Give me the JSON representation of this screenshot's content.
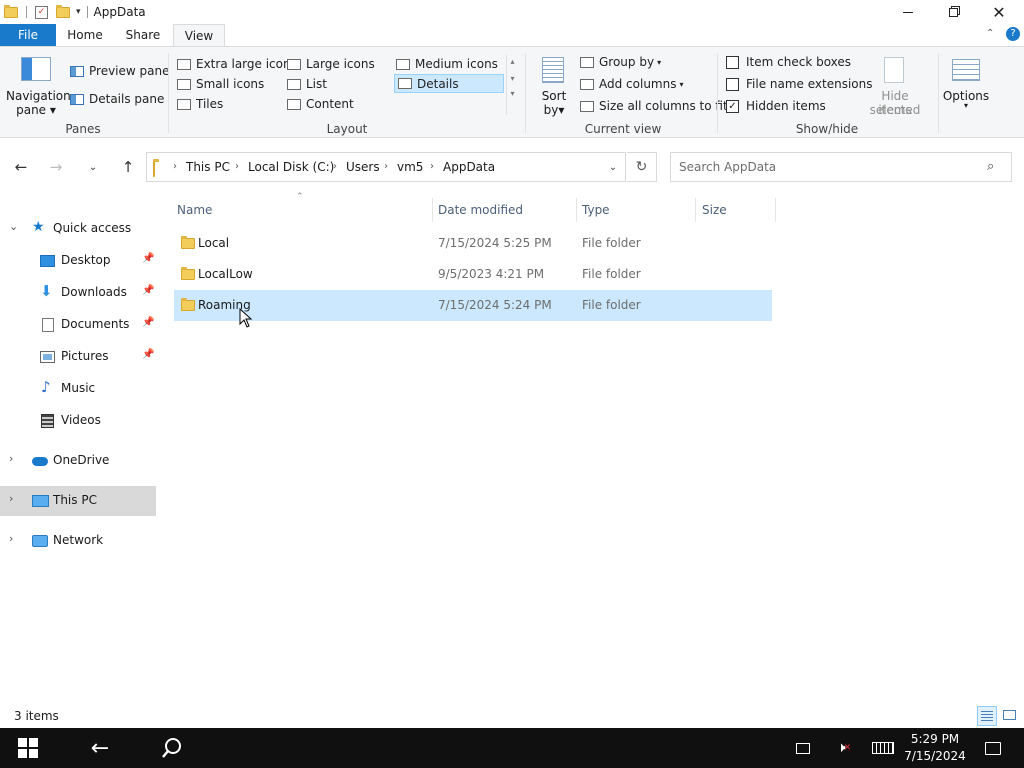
{
  "window": {
    "title": "AppData"
  },
  "tabs": {
    "file": "File",
    "home": "Home",
    "share": "Share",
    "view": "View"
  },
  "ribbon": {
    "panes": {
      "navigation_pane": [
        "Navigation",
        "pane"
      ],
      "preview_pane": "Preview pane",
      "details_pane": "Details pane",
      "label": "Panes"
    },
    "layout": {
      "extra_large_icons": "Extra large icons",
      "large_icons": "Large icons",
      "medium_icons": "Medium icons",
      "small_icons": "Small icons",
      "list": "List",
      "details": "Details",
      "tiles": "Tiles",
      "content": "Content",
      "label": "Layout"
    },
    "current_view": {
      "sort_by": [
        "Sort",
        "by"
      ],
      "group_by": "Group by",
      "add_columns": "Add columns",
      "size_all_columns": "Size all columns to fit",
      "label": "Current view"
    },
    "show_hide": {
      "item_check_boxes": "Item check boxes",
      "file_name_extensions": "File name extensions",
      "hidden_items": "Hidden items",
      "item_check_boxes_checked": false,
      "file_name_extensions_checked": false,
      "hidden_items_checked": true,
      "hide_selected": [
        "Hide selected",
        "items"
      ],
      "label": "Show/hide"
    },
    "options": "Options"
  },
  "address": {
    "breadcrumbs": [
      "This PC",
      "Local Disk (C:)",
      "Users",
      "vm5",
      "AppData"
    ]
  },
  "search": {
    "placeholder": "Search AppData"
  },
  "nav": {
    "quick_access": "Quick access",
    "desktop": "Desktop",
    "downloads": "Downloads",
    "documents": "Documents",
    "pictures": "Pictures",
    "music": "Music",
    "videos": "Videos",
    "onedrive": "OneDrive",
    "this_pc": "This PC",
    "network": "Network"
  },
  "columns": {
    "name": "Name",
    "date_modified": "Date modified",
    "type": "Type",
    "size": "Size"
  },
  "files": [
    {
      "name": "Local",
      "date": "7/15/2024 5:25 PM",
      "type": "File folder",
      "size": ""
    },
    {
      "name": "LocalLow",
      "date": "9/5/2023 4:21 PM",
      "type": "File folder",
      "size": ""
    },
    {
      "name": "Roaming",
      "date": "7/15/2024 5:24 PM",
      "type": "File folder",
      "size": ""
    }
  ],
  "status": {
    "item_count": "3 items"
  },
  "taskbar": {
    "time": "5:29 PM",
    "date": "7/15/2024"
  },
  "colors": {
    "accent": "#1979ca",
    "selection": "#cce8ff",
    "taskbar": "#101010",
    "folder": "#f3cd5a"
  }
}
